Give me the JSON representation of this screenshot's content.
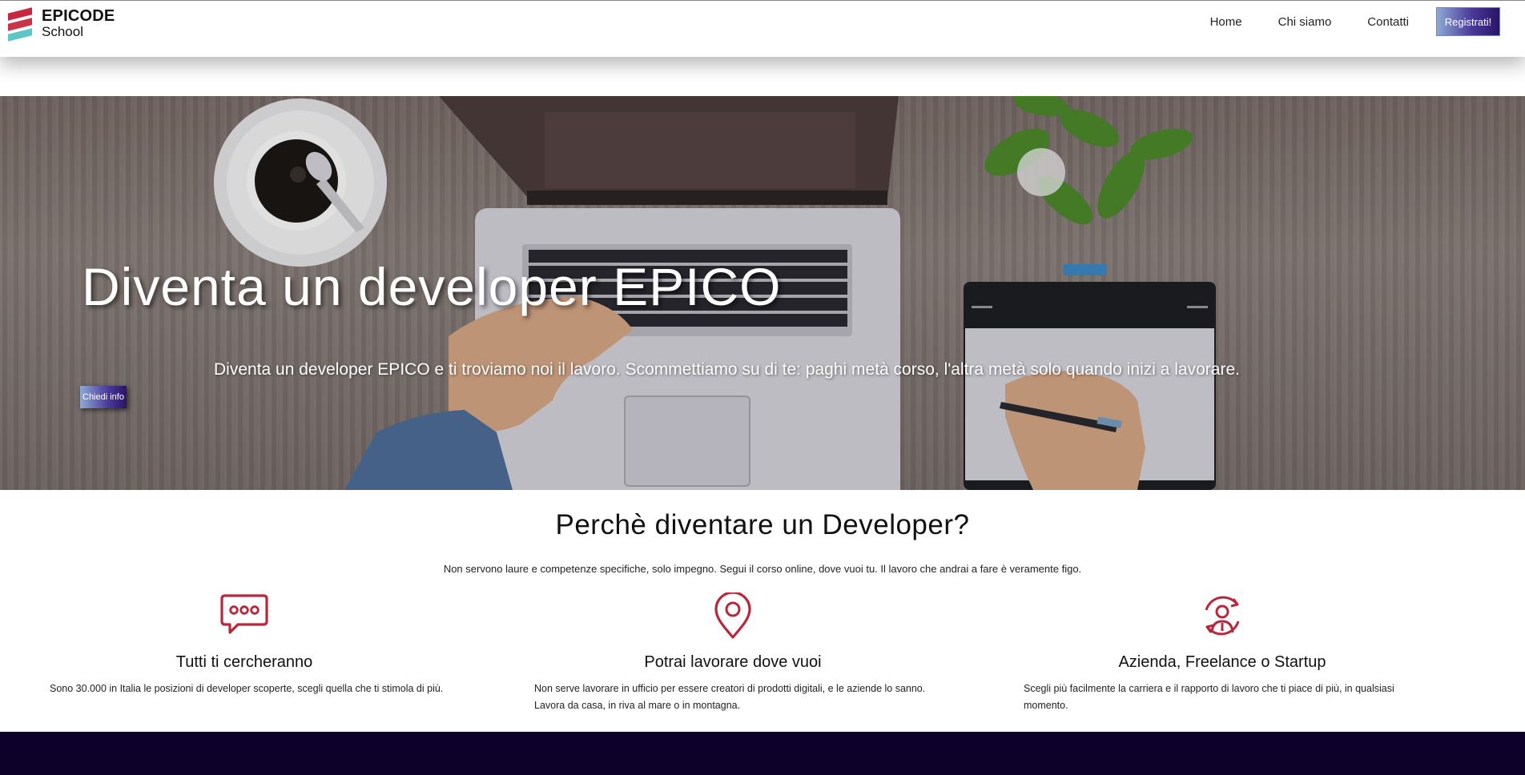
{
  "brand": {
    "line1": "EPICODE",
    "line2": "School"
  },
  "nav": {
    "items": [
      {
        "label": "Home"
      },
      {
        "label": "Chi siamo"
      },
      {
        "label": "Contatti"
      }
    ],
    "cta_label": "Registrati!"
  },
  "hero": {
    "title": "Diventa un developer EPICO",
    "subtitle": "Diventa un developer EPICO e ti troviamo noi il lavoro. Scommettiamo su di te: paghi metà corso, l'altra metà solo quando inizi a lavorare.",
    "button_label": "Chiedi info"
  },
  "why": {
    "title": "Perchè diventare un Developer?",
    "subtitle": "Non servono laure e competenze specifiche, solo impegno. Segui il corso online, dove vuoi tu. Il lavoro che andrai a fare è veramente figo.",
    "features": [
      {
        "icon": "chat-bubble-icon",
        "title": "Tutti ti cercheranno",
        "text": "Sono 30.000 in Italia le posizioni di developer scoperte, scegli quella che ti stimola di più."
      },
      {
        "icon": "location-pin-icon",
        "title": "Potrai lavorare dove vuoi",
        "text": "Non serve lavorare in ufficio per essere creatori di prodotti digitali, e le aziende lo sanno. Lavora da casa, in riva al mare o in montagna."
      },
      {
        "icon": "user-switch-icon",
        "title": "Azienda, Freelance o Startup",
        "text": "Scegli più facilmente la carriera e il rapporto di lavoro che ti piace di più, in qualsiasi momento."
      }
    ]
  },
  "colors": {
    "accent": "#b8283a",
    "button_gradient_start": "#8fa9d6",
    "button_gradient_end": "#2a1466",
    "footer": "#0d0029"
  }
}
